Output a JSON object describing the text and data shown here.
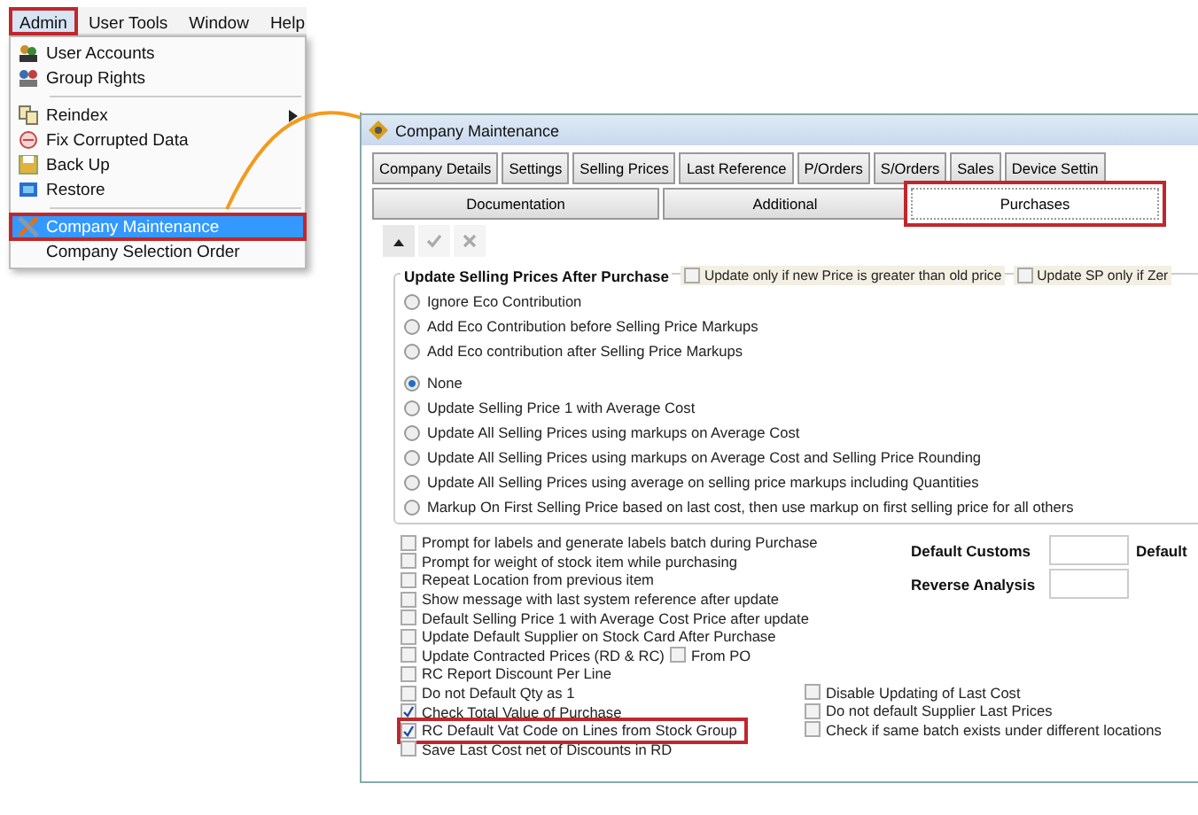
{
  "menu": {
    "menubar": [
      {
        "label": "Admin",
        "selected": true,
        "highlighted": true
      },
      {
        "label": "User Tools",
        "selected": false,
        "highlighted": false
      },
      {
        "label": "Window",
        "selected": false,
        "highlighted": false
      },
      {
        "label": "Help",
        "selected": false,
        "highlighted": false
      }
    ],
    "items": [
      {
        "kind": "item",
        "label": "User Accounts",
        "selected": false,
        "highlighted": false,
        "submenu": false
      },
      {
        "kind": "item",
        "label": "Group Rights",
        "selected": false,
        "highlighted": false,
        "submenu": false
      },
      {
        "kind": "separator"
      },
      {
        "kind": "item",
        "label": "Reindex",
        "selected": false,
        "highlighted": false,
        "submenu": true
      },
      {
        "kind": "item",
        "label": "Fix Corrupted Data",
        "selected": false,
        "highlighted": false,
        "submenu": false
      },
      {
        "kind": "item",
        "label": "Back Up",
        "selected": false,
        "highlighted": false,
        "submenu": false
      },
      {
        "kind": "item",
        "label": "Restore",
        "selected": false,
        "highlighted": false,
        "submenu": false
      },
      {
        "kind": "separator"
      },
      {
        "kind": "item",
        "label": "Company Maintenance",
        "selected": true,
        "highlighted": true,
        "submenu": false
      },
      {
        "kind": "item",
        "label": "Company Selection Order",
        "selected": false,
        "highlighted": false,
        "submenu": false
      }
    ]
  },
  "window": {
    "title": "Company Maintenance",
    "tabs_row_1": [
      {
        "label": "Company Details",
        "selected": false
      },
      {
        "label": "Settings",
        "selected": false
      },
      {
        "label": "Selling Prices",
        "selected": false
      },
      {
        "label": "Last Reference",
        "selected": false
      },
      {
        "label": "P/Orders",
        "selected": false
      },
      {
        "label": "S/Orders",
        "selected": false
      },
      {
        "label": "Sales",
        "selected": false
      },
      {
        "label": "Device Settin",
        "selected": false
      }
    ],
    "tabs_row_2": [
      {
        "label": "Documentation",
        "selected": false,
        "highlighted": false
      },
      {
        "label": "Additional",
        "selected": false,
        "highlighted": false
      },
      {
        "label": "Purchases",
        "selected": true,
        "highlighted": true
      }
    ],
    "toolbar": [
      {
        "kind": "up",
        "disabled": false
      },
      {
        "kind": "check",
        "disabled": true
      },
      {
        "kind": "cancel",
        "disabled": true
      }
    ],
    "group": {
      "title": "Update Selling Prices After Purchase",
      "header_options": [
        {
          "label": "Update only if new Price is greater than old price",
          "checked": false
        },
        {
          "label": "Update SP only if Zer",
          "checked": false
        }
      ],
      "eco_options": [
        {
          "label": "Ignore Eco Contribution",
          "selected": false
        },
        {
          "label": "Add Eco Contribution before Selling Price Markups",
          "selected": false
        },
        {
          "label": "Add Eco contribution after Selling Price Markups",
          "selected": false
        }
      ],
      "price_options": [
        {
          "label": "None",
          "selected": true
        },
        {
          "label": "Update Selling Price 1 with Average Cost",
          "selected": false
        },
        {
          "label": "Update All Selling Prices using markups on Average Cost",
          "selected": false
        },
        {
          "label": "Update All Selling Prices using markups on Average Cost and Selling Price Rounding",
          "selected": false
        },
        {
          "label": "Update All Selling Prices using average on selling price markups including Quantities",
          "selected": false
        },
        {
          "label": "Markup On First Selling Price based on last cost, then use markup on first selling price for all others",
          "selected": false
        }
      ]
    },
    "options": [
      {
        "label": "Prompt for labels and generate labels batch during Purchase",
        "checked": false,
        "highlighted": false
      },
      {
        "label": "Prompt for weight of stock item while purchasing",
        "checked": false,
        "highlighted": false
      },
      {
        "label": "Repeat Location from previous item",
        "checked": false,
        "highlighted": false
      },
      {
        "label": "Show message with last system reference after update",
        "checked": false,
        "highlighted": false
      },
      {
        "label": "Default Selling Price 1 with Average Cost Price after update",
        "checked": false,
        "highlighted": false
      },
      {
        "label": "Update Default Supplier on Stock Card After Purchase",
        "checked": false,
        "highlighted": false
      },
      {
        "label": "Update Contracted Prices (RD & RC)",
        "checked": false,
        "highlighted": false,
        "extra": {
          "label": "From PO",
          "checked": false
        }
      },
      {
        "label": "RC Report Discount Per Line",
        "checked": false,
        "highlighted": false
      },
      {
        "label": "Do not Default Qty as 1",
        "checked": false,
        "highlighted": false
      },
      {
        "label": "Check Total Value of Purchase",
        "checked": true,
        "highlighted": false
      },
      {
        "label": "RC Default Vat Code on Lines from Stock Group",
        "checked": true,
        "highlighted": true
      },
      {
        "label": "Save Last Cost net of Discounts in RD",
        "checked": false,
        "highlighted": false
      }
    ],
    "fields": [
      {
        "label": "Default Customs",
        "next_label": "Default"
      },
      {
        "label": "Reverse Analysis"
      }
    ],
    "right_options": [
      {
        "label": "Disable Updating of Last Cost",
        "checked": false
      },
      {
        "label": "Do not default Supplier Last Prices",
        "checked": false
      },
      {
        "label": "Check if same batch exists under different locations",
        "checked": false
      }
    ]
  }
}
